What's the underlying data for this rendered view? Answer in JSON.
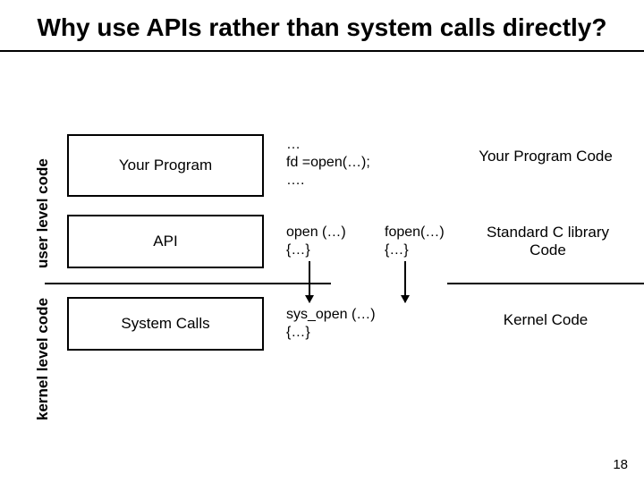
{
  "title": "Why use APIs rather than system calls directly?",
  "sections": {
    "user_label": "user level code",
    "kernel_label": "kernel level code"
  },
  "boxes": {
    "program": "Your Program",
    "api": "API",
    "syscalls": "System Calls"
  },
  "snippets": {
    "program_code": "…\nfd =open(…);\n….",
    "api_open": "open (…)\n{…}",
    "api_fopen": "fopen(…)\n{…}",
    "sys_open": "sys_open (…)\n{…}"
  },
  "right_labels": {
    "program": "Your Program Code",
    "api": "Standard C library\nCode",
    "syscalls": "Kernel Code"
  },
  "page_number": "18"
}
